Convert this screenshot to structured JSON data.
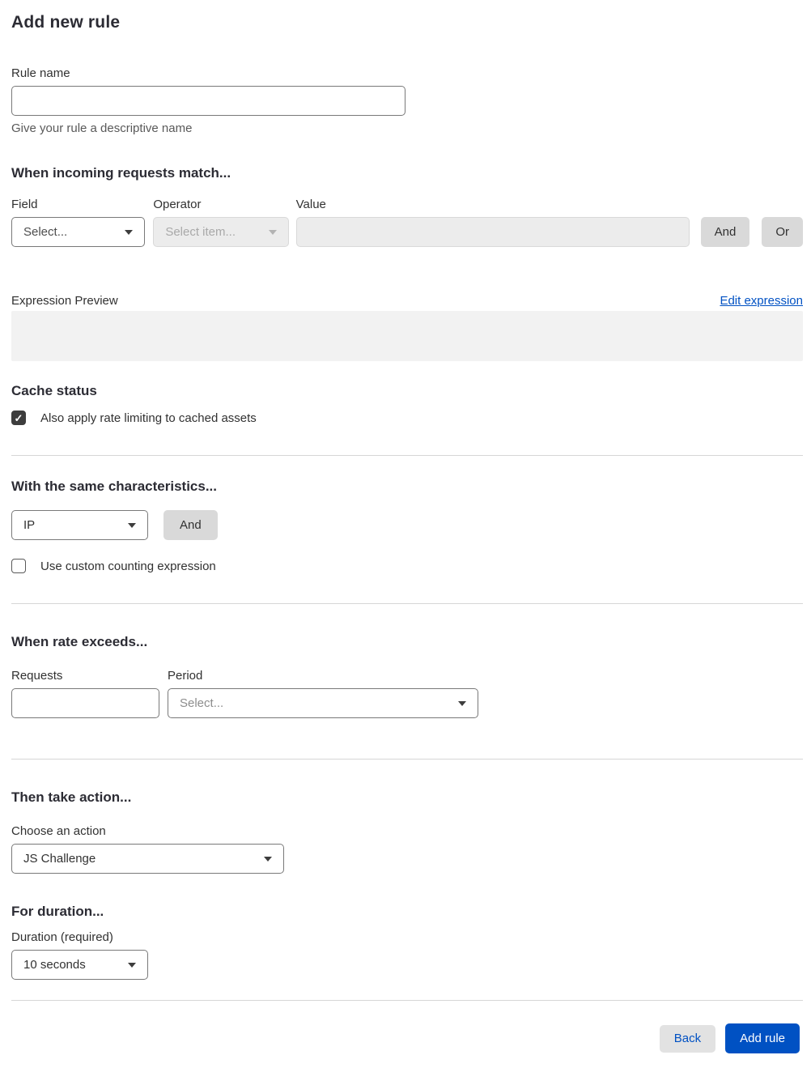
{
  "title": "Add new rule",
  "colors": {
    "accent_blue": "#0051c3",
    "heading_text": "#2c2c34",
    "body_text": "#313131",
    "muted_text": "#595959",
    "divider": "#d6d6d6",
    "disabled_bg": "#ececec",
    "preview_bg": "#f2f2f2",
    "checkbox_checked": "#3d3d3d",
    "gray_button_bg": "#d9d9d9"
  },
  "icons": {
    "check": "✓"
  },
  "rule_name": {
    "label": "Rule name",
    "value": "",
    "helper": "Give your rule a descriptive name"
  },
  "match": {
    "heading": "When incoming requests match...",
    "field_label": "Field",
    "field_value": "Select...",
    "operator_label": "Operator",
    "operator_value": "Select item...",
    "value_label": "Value",
    "value_text": "",
    "and_label": "And",
    "or_label": "Or"
  },
  "expression": {
    "preview_label": "Expression Preview",
    "edit_link": "Edit expression",
    "value": ""
  },
  "cache": {
    "heading": "Cache status",
    "checkbox_label": "Also apply rate limiting to cached assets",
    "checked": true
  },
  "characteristics": {
    "heading": "With the same characteristics...",
    "select_value": "IP",
    "and_label": "And",
    "checkbox_label": "Use custom counting expression",
    "checked": false
  },
  "rate": {
    "heading": "When rate exceeds...",
    "requests_label": "Requests",
    "requests_value": "",
    "period_label": "Period",
    "period_value": "Select..."
  },
  "action": {
    "heading": "Then take action...",
    "label": "Choose an action",
    "value": "JS Challenge"
  },
  "duration": {
    "heading": "For duration...",
    "label": "Duration (required)",
    "value": "10 seconds"
  },
  "footer": {
    "back": "Back",
    "add_rule": "Add rule"
  }
}
